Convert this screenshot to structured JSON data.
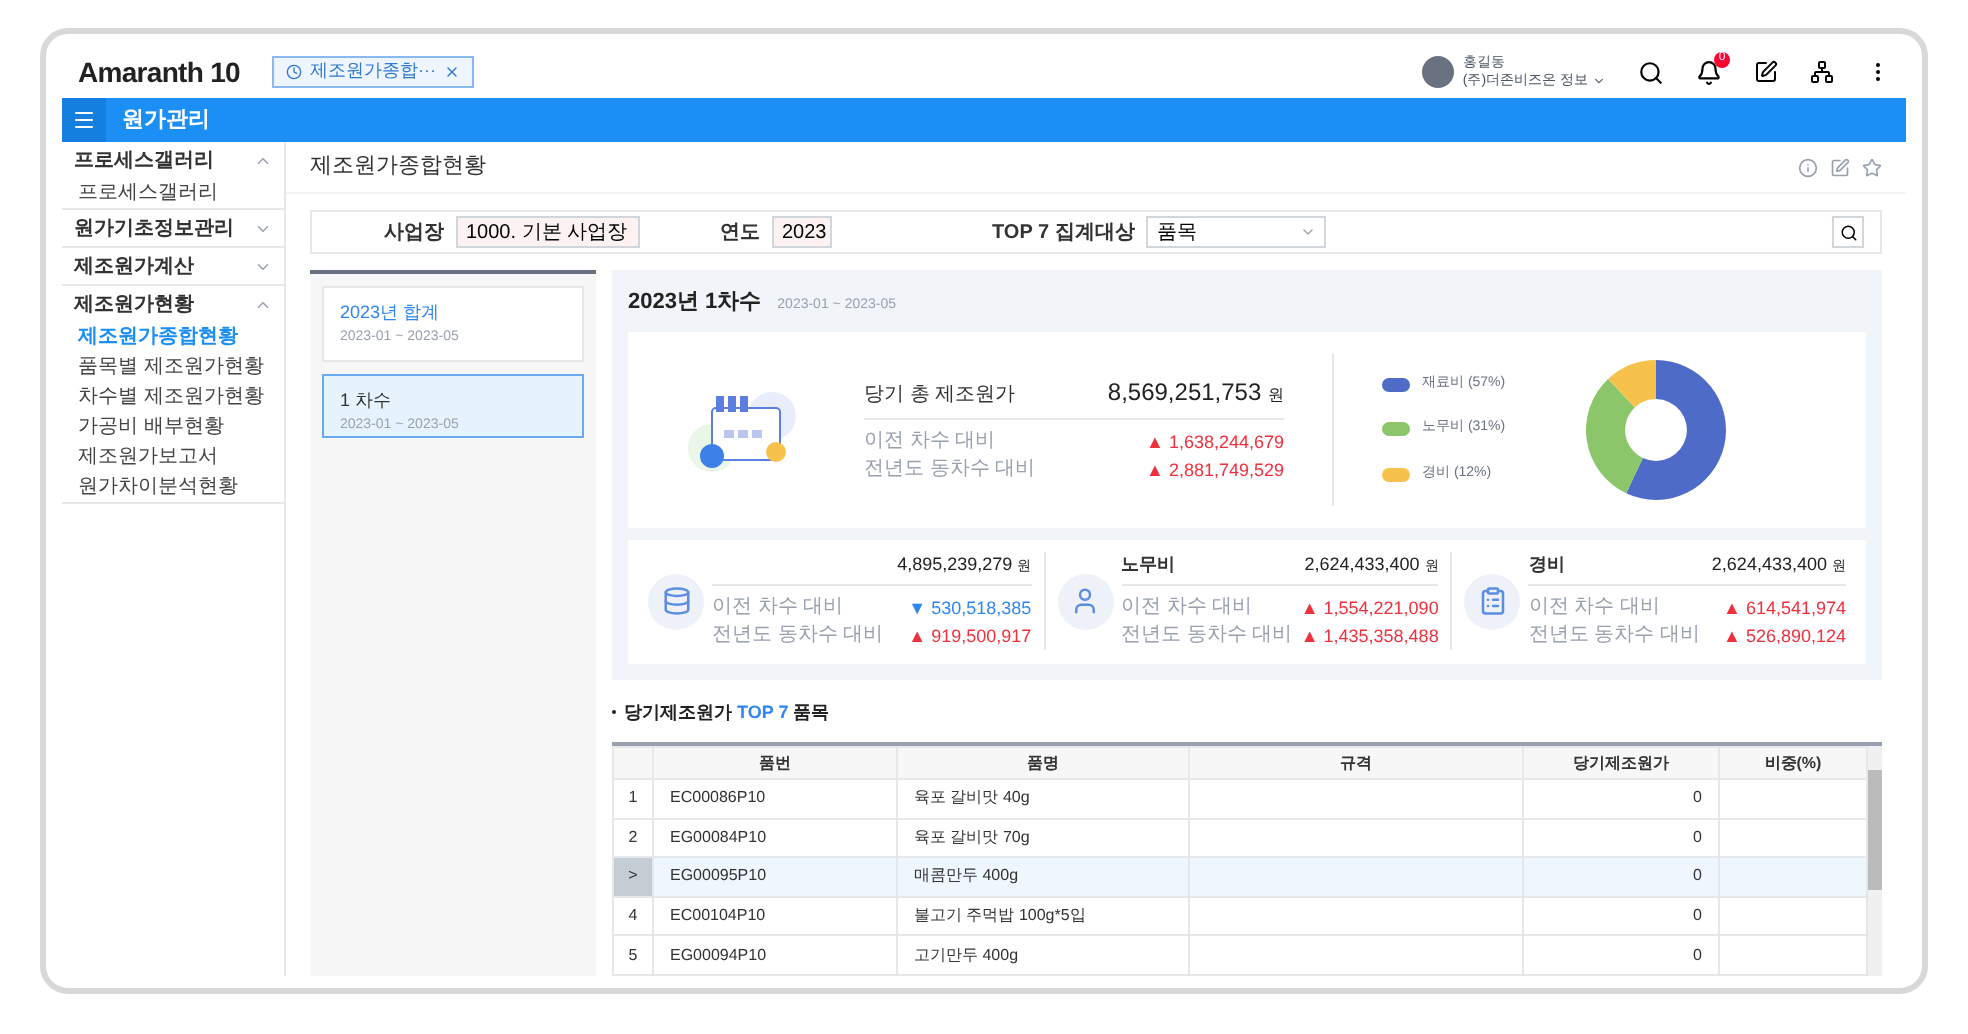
{
  "header": {
    "logo": "Amaranth 10",
    "open_tab": {
      "label": "제조원가종합···",
      "selected": true
    },
    "user": {
      "name": "홍길동",
      "company": "(주)더존비즈온 정보"
    },
    "notification_count": "0"
  },
  "module_bar": {
    "title": "원가관리"
  },
  "sidebar": {
    "items": [
      {
        "label": "프로세스갤러리",
        "expanded": true,
        "children": [
          {
            "label": "프로세스갤러리",
            "selected": false
          }
        ]
      },
      {
        "label": "원가기초정보관리",
        "expanded": false
      },
      {
        "label": "제조원가계산",
        "expanded": false
      },
      {
        "label": "제조원가현황",
        "expanded": true,
        "children": [
          {
            "label": "제조원가종합현황",
            "selected": true
          },
          {
            "label": "품목별 제조원가현황",
            "selected": false
          },
          {
            "label": "차수별 제조원가현황",
            "selected": false
          },
          {
            "label": "가공비 배부현황",
            "selected": false
          },
          {
            "label": "제조원가보고서",
            "selected": false
          },
          {
            "label": "원가차이분석현황",
            "selected": false
          }
        ]
      }
    ]
  },
  "page": {
    "title": "제조원가종합현황"
  },
  "filters": [
    {
      "label": "사업장",
      "value": "1000. 기본 사업장",
      "kind": "picker"
    },
    {
      "label": "연도",
      "value": "2023",
      "kind": "calendar"
    },
    {
      "label": "TOP 7 집계대상",
      "value": "품목",
      "kind": "select"
    }
  ],
  "periods": [
    {
      "title": "2023년 합계",
      "range": "2023-01 ~ 2023-05",
      "selected": false
    },
    {
      "title": "1 차수",
      "range": "2023-01 ~ 2023-05",
      "selected": true
    }
  ],
  "summary": {
    "title": "2023년 1차수",
    "range": "2023-01 ~ 2023-05",
    "total": {
      "label": "당기 총 제조원가",
      "amount": "8,569,251,753",
      "unit": "원",
      "compare": [
        {
          "label": "이전 차수 대비",
          "arrow": "▲",
          "value": "1,638,244,679",
          "increase": true
        },
        {
          "label": "전년도 동차수 대비",
          "arrow": "▲",
          "value": "2,881,749,529",
          "increase": true
        }
      ]
    },
    "chart_data": {
      "type": "donut",
      "categories": [
        "재료비 (57%)",
        "노무비 (31%)",
        "경비 (12%)"
      ],
      "series": [
        {
          "values": [
            57,
            31,
            12
          ]
        }
      ],
      "colors": [
        "#4f6bc8",
        "#8cc66a",
        "#f6c24c"
      ]
    },
    "costs": [
      {
        "kind": "material",
        "amount": "4,895,239,279",
        "unit": "원",
        "compare": [
          {
            "label": "이전 차수 대비",
            "arrow": "▼",
            "value": "530,518,385",
            "increase": false
          },
          {
            "label": "전년도 동차수 대비",
            "arrow": "▲",
            "value": "919,500,917",
            "increase": true
          }
        ]
      },
      {
        "kind": "labor",
        "label": "노무비",
        "amount": "2,624,433,400",
        "unit": "원",
        "compare": [
          {
            "label": "이전 차수 대비",
            "arrow": "▲",
            "value": "1,554,221,090",
            "increase": true
          },
          {
            "label": "전년도 동차수 대비",
            "arrow": "▲",
            "value": "1,435,358,488",
            "increase": true
          }
        ]
      },
      {
        "kind": "expense",
        "label": "경비",
        "amount": "2,624,433,400",
        "unit": "원",
        "compare": [
          {
            "label": "이전 차수 대비",
            "arrow": "▲",
            "value": "614,541,974",
            "increase": true
          },
          {
            "label": "전년도 동차수 대비",
            "arrow": "▲",
            "value": "526,890,124",
            "increase": true
          }
        ]
      }
    ]
  },
  "top_section": {
    "title_before": "당기제조원가 ",
    "title_highlight": "TOP 7",
    "title_after": " 품목"
  },
  "table": {
    "columns": [
      "품번",
      "품명",
      "규격",
      "당기제조원가",
      "비중(%)"
    ],
    "rows": [
      {
        "no": "1",
        "cells": [
          "EC00086P10",
          "육포 갈비맛 40g",
          "",
          "0",
          ""
        ],
        "selected": false
      },
      {
        "no": "2",
        "cells": [
          "EG00084P10",
          "육포 갈비맛 70g",
          "",
          "0",
          ""
        ],
        "selected": false
      },
      {
        "no": ">",
        "cells": [
          "EG00095P10",
          "매콤만두 400g",
          "",
          "0",
          ""
        ],
        "selected": true
      },
      {
        "no": "4",
        "cells": [
          "EC00104P10",
          "불고기 주먹밥 100g*5입",
          "",
          "0",
          ""
        ],
        "selected": false
      },
      {
        "no": "5",
        "cells": [
          "EG00094P10",
          "고기만두 400g",
          "",
          "0",
          ""
        ],
        "selected": false
      }
    ]
  }
}
